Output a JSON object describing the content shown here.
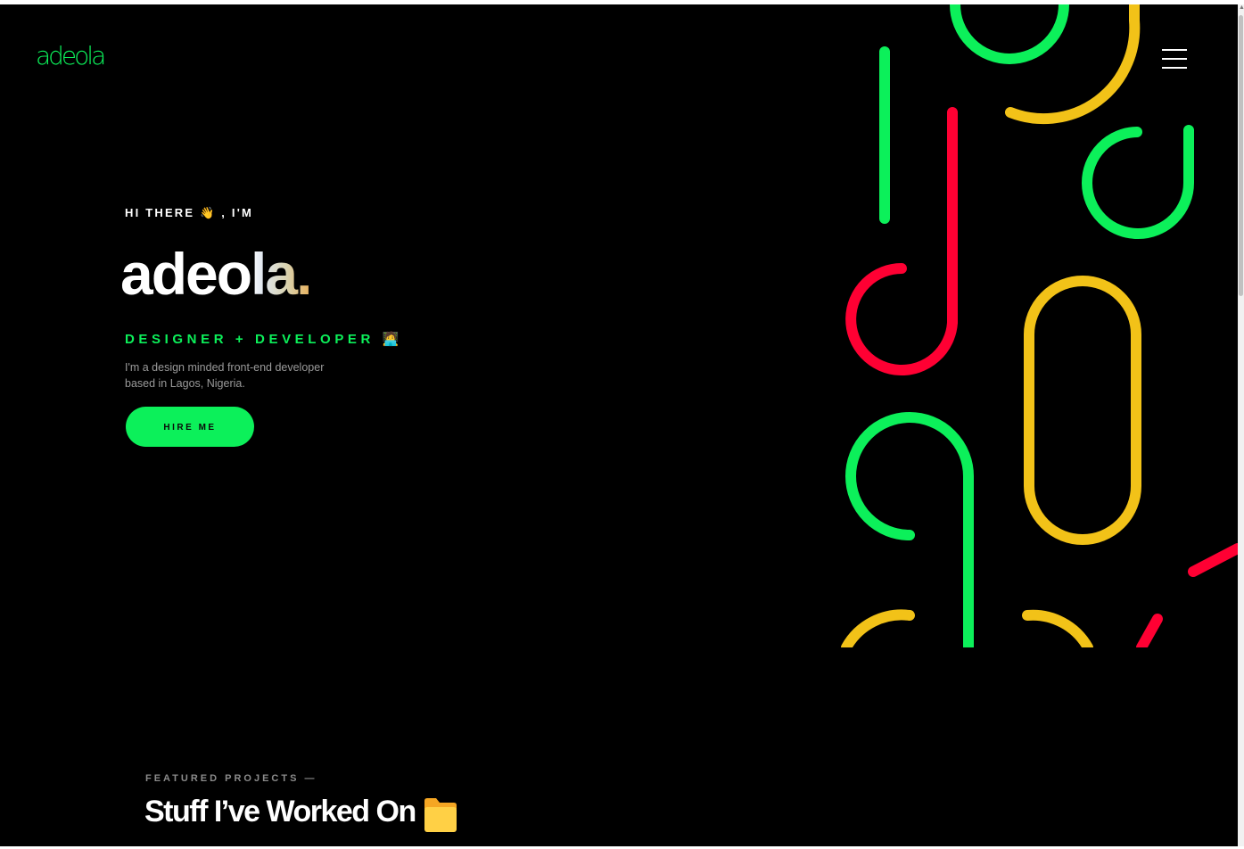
{
  "header": {
    "logo_text": "adeola",
    "menu_icon": "hamburger-menu-icon"
  },
  "hero": {
    "greeting": "HI THERE",
    "greeting_emoji": "👋",
    "greeting_suffix": ", I'M",
    "name_main": "adeo",
    "name_gradient": "la.",
    "role_text": "DESIGNER + DEVELOPER",
    "role_emoji": "🧑‍💻",
    "bio": "I'm a design minded front-end developer based in Lagos, Nigeria.",
    "cta_label": "HIRE ME"
  },
  "featured": {
    "eyebrow": "FEATURED PROJECTS —",
    "title": "Stuff I’ve Worked On",
    "title_icon": "folder-icon"
  },
  "colors": {
    "background": "#000000",
    "accent_green": "#0cf05a",
    "accent_red": "#ff0033",
    "accent_yellow": "#f2c218",
    "text_white": "#ffffff",
    "text_muted": "#9a9a9a"
  }
}
